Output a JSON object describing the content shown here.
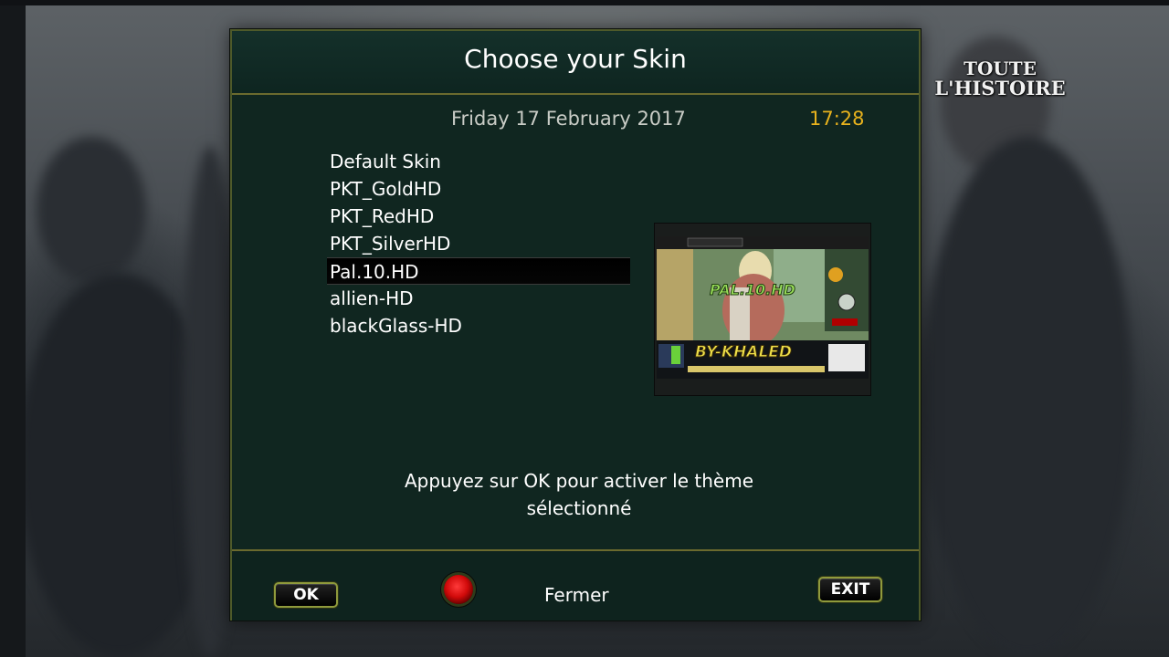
{
  "background": {
    "channel_logo_line1": "TOUTE",
    "channel_logo_line2": "L'HISTOIRE"
  },
  "dialog": {
    "title": "Choose your Skin",
    "date": "Friday 17 February 2017",
    "time": "17:28",
    "skins": [
      {
        "label": "Default Skin",
        "selected": false
      },
      {
        "label": "PKT_GoldHD",
        "selected": false
      },
      {
        "label": "PKT_RedHD",
        "selected": false
      },
      {
        "label": "PKT_SilverHD",
        "selected": false
      },
      {
        "label": "Pal.10.HD",
        "selected": true
      },
      {
        "label": "allien-HD",
        "selected": false
      },
      {
        "label": "blackGlass-HD",
        "selected": false
      }
    ],
    "preview": {
      "overlay_line1": "PAL.10.HD",
      "overlay_line2": "BY-KHALED"
    },
    "hint_line1": "Appuyez sur OK pour activer le thème",
    "hint_line2": "sélectionné"
  },
  "footer": {
    "ok_label": "OK",
    "red_button_label": "Fermer",
    "exit_label": "EXIT"
  },
  "colors": {
    "panel": "#102620",
    "accent_gold": "#e8b21d",
    "border_olive": "#6b6a2e",
    "red_key": "#d10a0a"
  }
}
